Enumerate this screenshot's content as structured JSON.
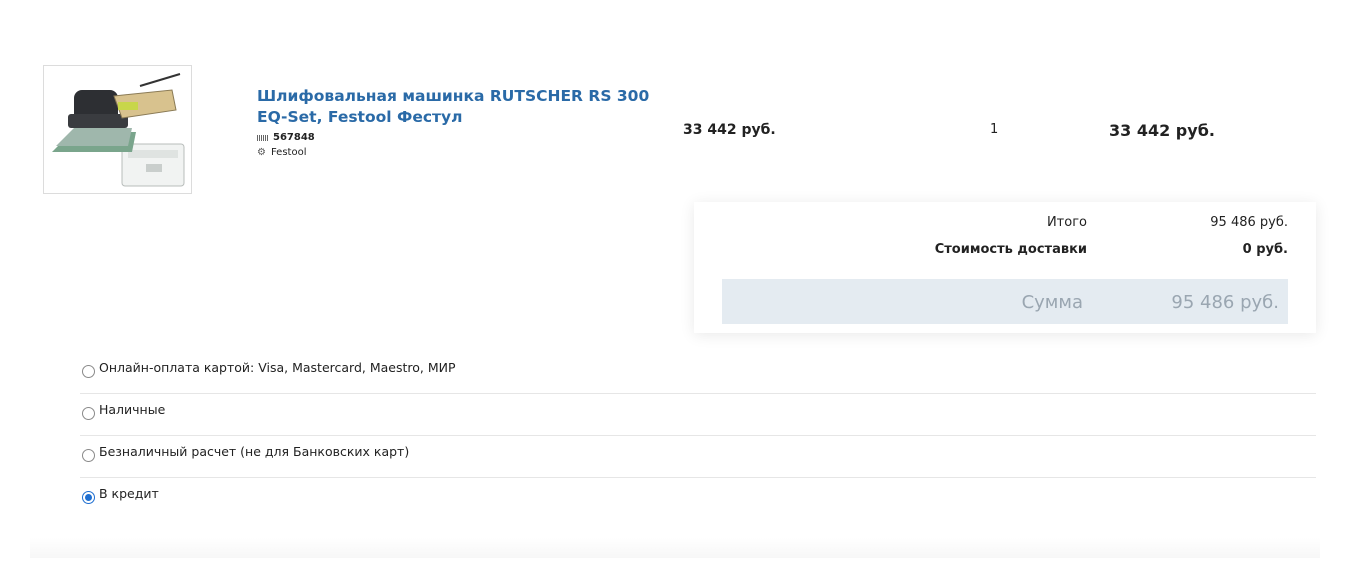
{
  "cart": {
    "item": {
      "title": "Шлифовальная машинка RUTSCHER RS 300 EQ-Set, Festool Фестул",
      "sku": "567848",
      "brand": "Festool",
      "price": "33 442 руб.",
      "quantity": "1",
      "line_total": "33 442 руб.",
      "sku_icon": "barcode-icon",
      "brand_icon": "gears-icon"
    }
  },
  "totals": {
    "subtotal_label": "Итого",
    "subtotal_value": "95 486 руб.",
    "delivery_label": "Стоимость доставки",
    "delivery_value": "0 руб.",
    "sum_label": "Сумма",
    "sum_value": "95 486 руб."
  },
  "payment": {
    "options": [
      {
        "label": "Онлайн-оплата картой: Visa, Mastercard, Maestro, МИР",
        "checked": false
      },
      {
        "label": "Наличные",
        "checked": false
      },
      {
        "label": "Безналичный расчет (не для Банковских карт)",
        "checked": false
      },
      {
        "label": "В кредит",
        "checked": true
      }
    ]
  },
  "colors": {
    "link": "#2a6aa7",
    "sum_bar": "#e4ebf1",
    "radio_selected": "#1f6fd1"
  }
}
